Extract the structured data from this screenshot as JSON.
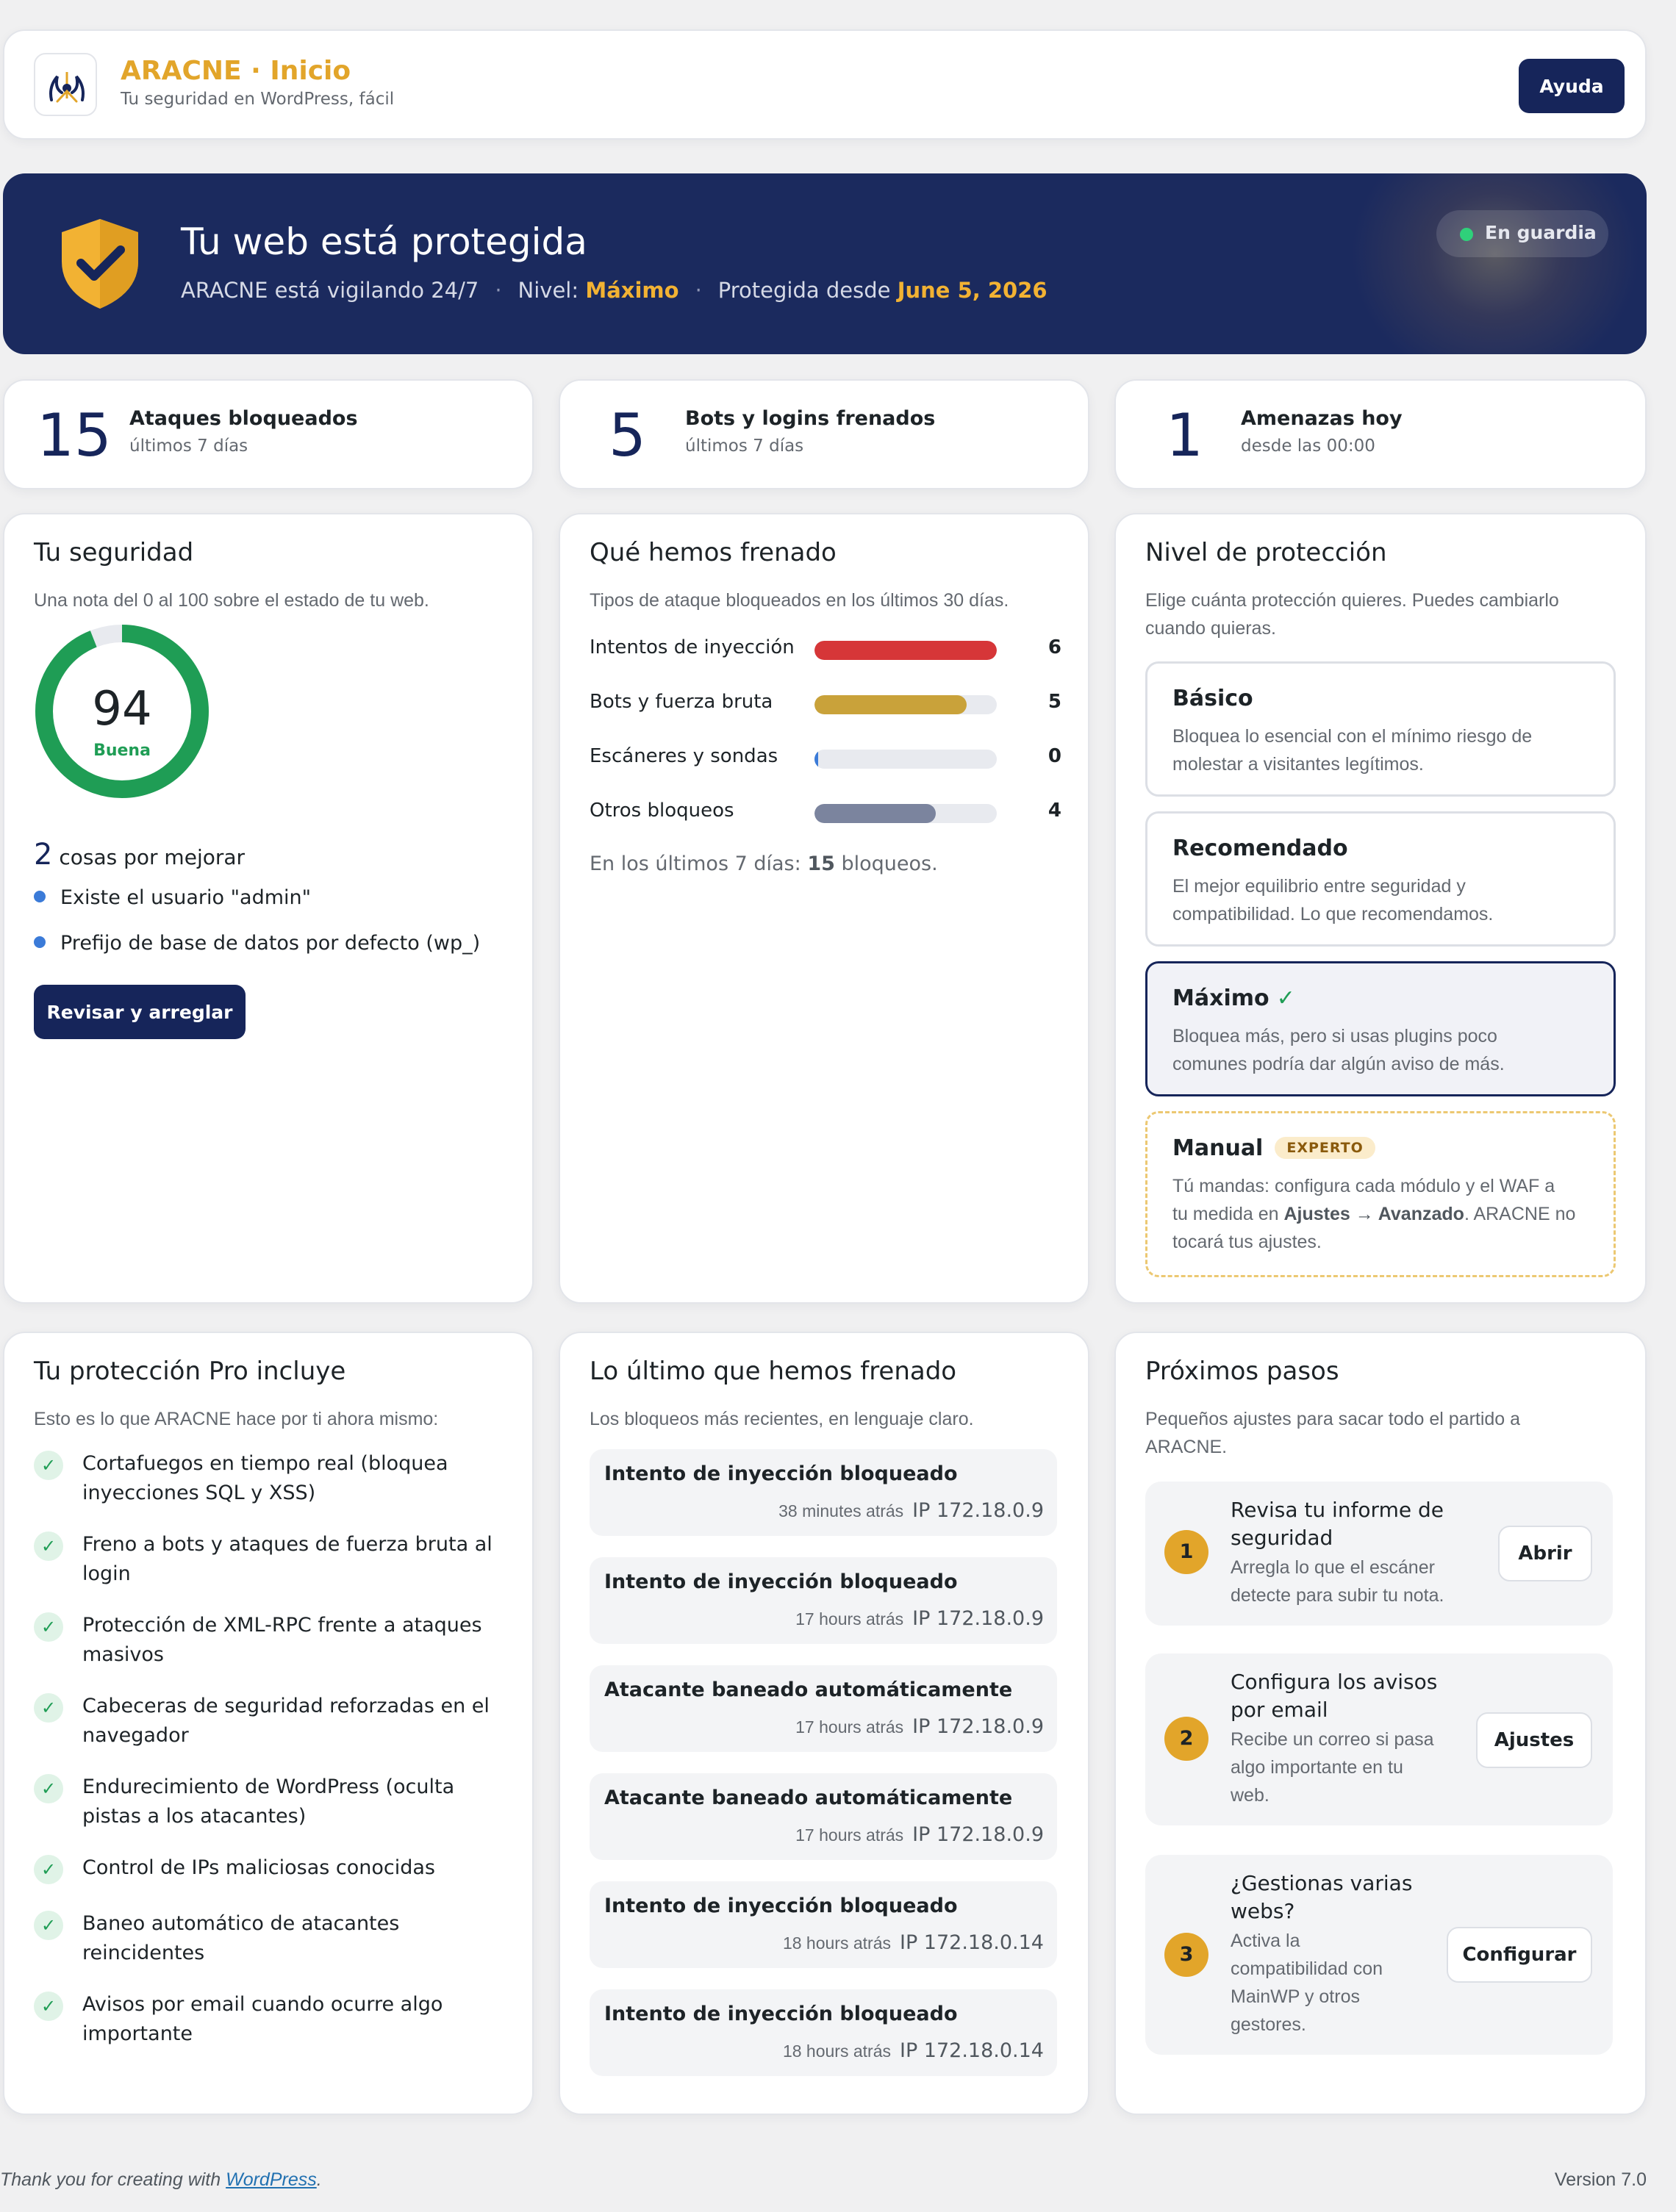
{
  "header": {
    "brand": "ARACNE · Inicio",
    "tagline": "Tu seguridad en WordPress, fácil",
    "help_label": "Ayuda"
  },
  "hero": {
    "title": "Tu web está protegida",
    "watching": "ARACNE está vigilando 24/7",
    "level_prefix": "Nivel:",
    "level_value": "Máximo",
    "since_prefix": "Protegida desde",
    "since_value": "June 5, 2026",
    "badge": "En guardia"
  },
  "stats": [
    {
      "value": "15",
      "label": "Ataques bloqueados",
      "sub": "últimos 7 días"
    },
    {
      "value": "5",
      "label": "Bots y logins frenados",
      "sub": "últimos 7 días"
    },
    {
      "value": "1",
      "label": "Amenazas hoy",
      "sub": "desde las 00:00"
    }
  ],
  "security": {
    "title": "Tu seguridad",
    "desc": "Una nota del 0 al 100 sobre el estado de tu web.",
    "score": 94,
    "score_label": "Buena",
    "improve_count": "2",
    "improve_text": "cosas por mejorar",
    "issues": [
      "Existe el usuario \"admin\"",
      "Prefijo de base de datos por defecto (wp_)"
    ],
    "fix_label": "Revisar y arreglar",
    "ring_color": "#1f9d55"
  },
  "blocked": {
    "title": "Qué hemos frenado",
    "desc": "Tipos de ataque bloqueados en los últimos 30 días.",
    "max": 6,
    "rows": [
      {
        "label": "Intentos de inyección",
        "value": 6,
        "color": "#d63638"
      },
      {
        "label": "Bots y fuerza bruta",
        "value": 5,
        "color": "#c9a23a"
      },
      {
        "label": "Escáneres y sondas",
        "value": 0,
        "color": "#3b7bd8"
      },
      {
        "label": "Otros bloqueos",
        "value": 4,
        "color": "#7b849e"
      }
    ],
    "summary_prefix": "En los últimos 7 días:",
    "summary_count": "15",
    "summary_suffix": "bloqueos."
  },
  "levels": {
    "title": "Nivel de protección",
    "desc_line1": "Elige cuánta protección quieres. Puedes cambiarlo",
    "desc_line2": "cuando quieras.",
    "basic": {
      "name": "Básico",
      "d1": "Bloquea lo esencial con el mínimo riesgo de",
      "d2": "molestar a visitantes legítimos."
    },
    "recommended": {
      "name": "Recomendado",
      "d1": "El mejor equilibrio entre seguridad y",
      "d2": "compatibilidad. Lo que recomendamos."
    },
    "max": {
      "name": "Máximo",
      "check": "✓",
      "d1": "Bloquea más, pero si usas plugins poco",
      "d2": "comunes podría dar algún aviso de más."
    },
    "manual": {
      "name": "Manual",
      "badge": "EXPERTO",
      "d1": "Tú mandas: configura cada módulo y el WAF a",
      "d2a": "tu medida en",
      "d2b": "Ajustes → Avanzado",
      "d2c": ". ARACNE no",
      "d3": "tocará tus ajustes."
    }
  },
  "pro": {
    "title": "Tu protección Pro incluye",
    "desc": "Esto es lo que ARACNE hace por ti ahora mismo:",
    "items": [
      {
        "l1": "Cortafuegos en tiempo real (bloquea",
        "l2": "inyecciones SQL y XSS)"
      },
      {
        "l1": "Freno a bots y ataques de fuerza bruta al",
        "l2": "login"
      },
      {
        "l1": "Protección de XML-RPC frente a ataques",
        "l2": "masivos"
      },
      {
        "l1": "Cabeceras de seguridad reforzadas en el",
        "l2": "navegador"
      },
      {
        "l1": "Endurecimiento de WordPress (oculta",
        "l2": "pistas a los atacantes)"
      },
      {
        "l1": "Control de IPs maliciosas conocidas",
        "l2": ""
      },
      {
        "l1": "Baneo automático de atacantes",
        "l2": "reincidentes"
      },
      {
        "l1": "Avisos por email cuando ocurre algo",
        "l2": "importante"
      }
    ]
  },
  "recent": {
    "title": "Lo último que hemos frenado",
    "desc": "Los bloqueos más recientes, en lenguaje claro.",
    "items": [
      {
        "title": "Intento de inyección bloqueado",
        "time": "38 minutes atrás",
        "ip": "IP 172.18.0.9"
      },
      {
        "title": "Intento de inyección bloqueado",
        "time": "17 hours atrás",
        "ip": "IP 172.18.0.9"
      },
      {
        "title": "Atacante baneado automáticamente",
        "time": "17 hours atrás",
        "ip": "IP 172.18.0.9"
      },
      {
        "title": "Atacante baneado automáticamente",
        "time": "17 hours atrás",
        "ip": "IP 172.18.0.9"
      },
      {
        "title": "Intento de inyección bloqueado",
        "time": "18 hours atrás",
        "ip": "IP 172.18.0.14"
      },
      {
        "title": "Intento de inyección bloqueado",
        "time": "18 hours atrás",
        "ip": "IP 172.18.0.14"
      }
    ]
  },
  "steps": {
    "title": "Próximos pasos",
    "desc_line1": "Pequeños ajustes para sacar todo el partido a",
    "desc_line2": "ARACNE.",
    "items": [
      {
        "num": "1",
        "t1": "Revisa tu informe de",
        "t2": "seguridad",
        "d1": "Arregla lo que el escáner",
        "d2": "detecte para subir tu nota.",
        "d3": "",
        "button": "Abrir"
      },
      {
        "num": "2",
        "t1": "Configura los avisos",
        "t2": "por email",
        "d1": "Recibe un correo si pasa",
        "d2": "algo importante en tu",
        "d3": "web.",
        "button": "Ajustes"
      },
      {
        "num": "3",
        "t1": "¿Gestionas varias",
        "t2": "webs?",
        "d1": "Activa la",
        "d2": "compatibilidad con",
        "d3": "MainWP y otros",
        "d4": "gestores.",
        "button": "Configurar"
      }
    ]
  },
  "footer": {
    "thanks_prefix": "Thank you for creating with",
    "thanks_link": "WordPress",
    "thanks_suffix": ".",
    "version": "Version 7.0"
  }
}
